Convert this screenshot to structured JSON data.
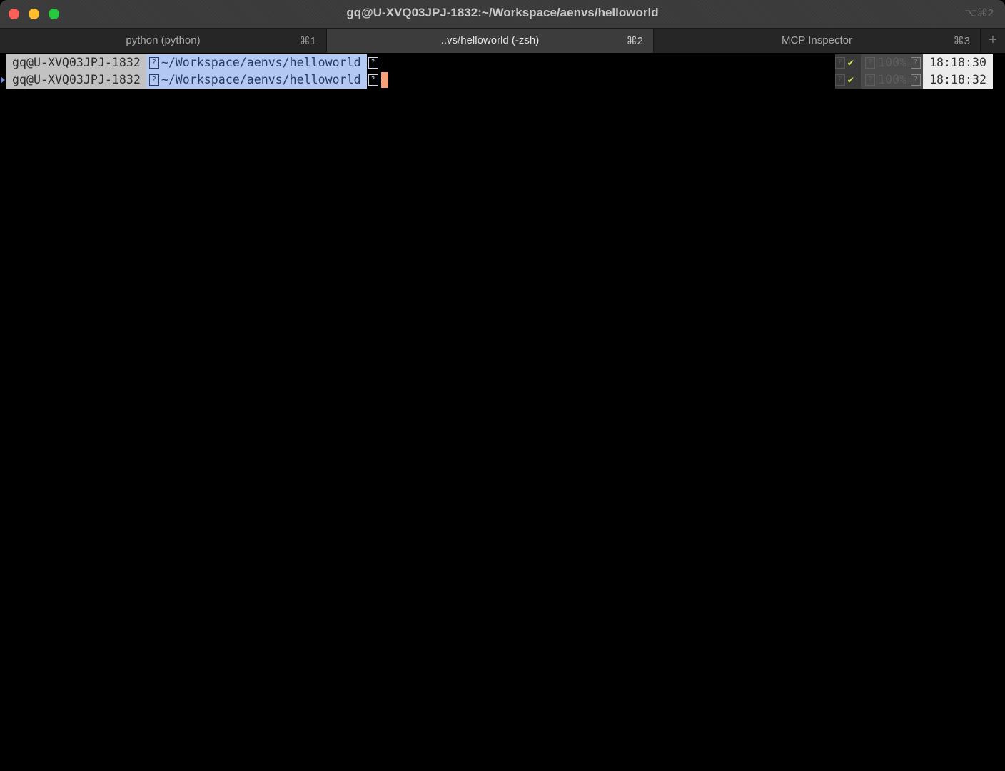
{
  "window": {
    "title": "gq@U-XVQ03JPJ-1832:~/Workspace/aenvs/helloworld",
    "shortcut": "⌥⌘2"
  },
  "tabs": [
    {
      "label": "python (python)",
      "key": "⌘1",
      "active": false
    },
    {
      "label": "..vs/helloworld (-zsh)",
      "key": "⌘2",
      "active": true
    },
    {
      "label": "MCP Inspector",
      "key": "⌘3",
      "active": false
    }
  ],
  "tab_add_label": "+",
  "terminal": {
    "lines": [
      {
        "user": "gq@U-XVQ03JPJ-1832",
        "path": "~/Workspace/aenvs/helloworld",
        "glyph": "?",
        "status": "✔",
        "history": "100%",
        "time": "18:18:30"
      },
      {
        "user": "gq@U-XVQ03JPJ-1832",
        "path": "~/Workspace/aenvs/helloworld",
        "glyph": "?",
        "status": "✔",
        "history": "100%",
        "time": "18:18:32"
      }
    ]
  },
  "colors": {
    "close": "#fe5f57",
    "minimize": "#febc2e",
    "maximize": "#28c840",
    "cursor": "#f5a27a",
    "path_segment": "#b3c9f4",
    "user_segment": "#c2c2c2"
  }
}
